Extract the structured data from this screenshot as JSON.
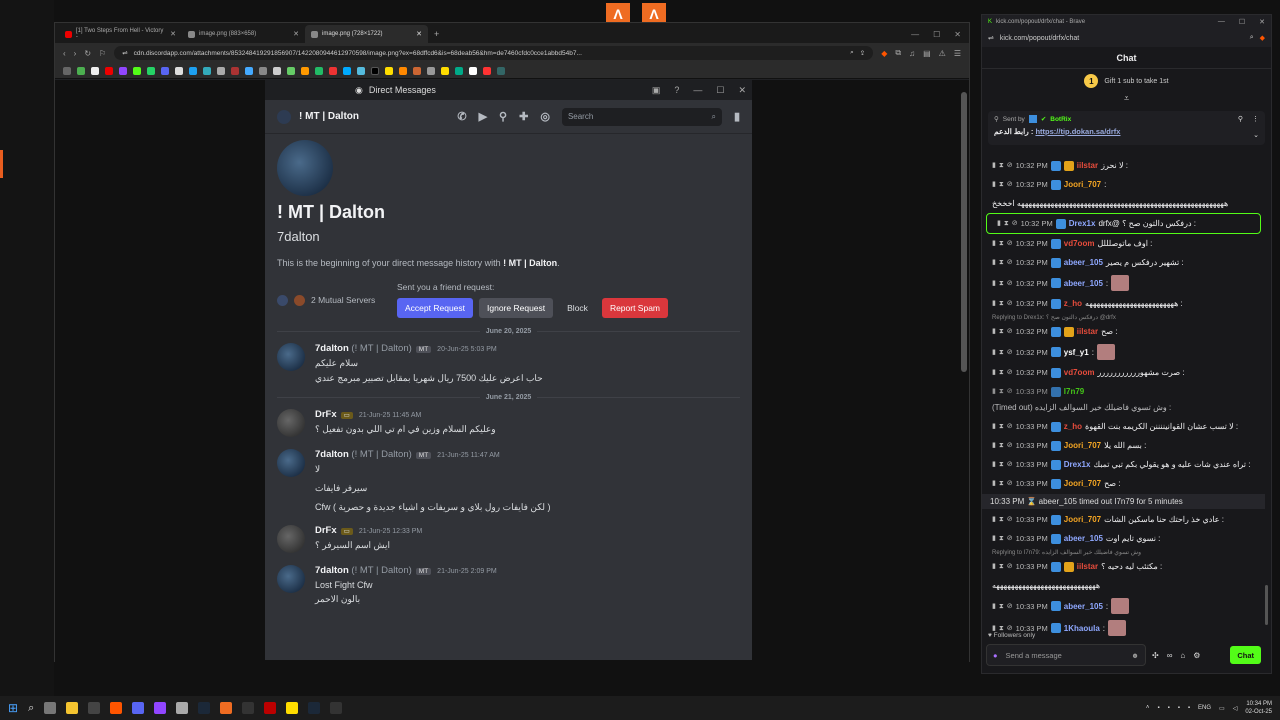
{
  "browser": {
    "tabs": [
      {
        "label": "[1] Two Steps From Hell - Victory - "
      },
      {
        "label": "image.png (883×658)"
      },
      {
        "label": "image.png (728×1722)"
      }
    ],
    "url": "cdn.discordapp.com/attachments/853248419291856907/1422080944612970598/image.png?ex=68dffcd6&is=68deab56&hm=de7460cfdc0cce1abbd54b7..."
  },
  "discord": {
    "window_title": "Direct Messages",
    "header_name": "! MT | Dalton",
    "search_placeholder": "Search",
    "profile_name": "! MT | Dalton",
    "username": "7dalton",
    "intro_prefix": "This is the beginning of your direct message history with ",
    "intro_name": "! MT | Dalton",
    "intro_suffix": ".",
    "mutual_servers": "2 Mutual Servers",
    "friend_request_label": "Sent you a friend request:",
    "accept": "Accept Request",
    "ignore": "Ignore Request",
    "block": "Block",
    "spam": "Report Spam",
    "dates": [
      "June 20, 2025",
      "June 21, 2025"
    ],
    "messages": [
      {
        "name": "7dalton",
        "sub": "(! MT | Dalton)",
        "tag": "MT",
        "time": "20-Jun-25 5:03 PM",
        "lines": [
          "سلام عليكم",
          "حاب اعرض عليك 7500 ريال شهريا بمقابل تصبير مبرمج عندي"
        ]
      },
      {
        "name": "DrFx",
        "sub": "",
        "tag": "",
        "time": "21-Jun-25 11:45 AM",
        "lines": [
          "وعليكم السلام وزين في ام تي اللي بدون تفعيل ؟"
        ]
      },
      {
        "name": "7dalton",
        "sub": "(! MT | Dalton)",
        "tag": "MT",
        "time": "21-Jun-25 11:47 AM",
        "lines": [
          "لا",
          "سيرفر فايفات",
          "Cfw ( لكن فايفات رول بلاي و سريفات و اشياء جديدة و حصرية )"
        ]
      },
      {
        "name": "DrFx",
        "sub": "",
        "tag": "",
        "time": "21-Jun-25 12:33 PM",
        "lines": [
          "ايش اسم السيرفر ؟"
        ]
      },
      {
        "name": "7dalton",
        "sub": "(! MT | Dalton)",
        "tag": "MT",
        "time": "21-Jun-25 2:09 PM",
        "lines": [
          "Lost Fight Cfw",
          "بالون الاحمر"
        ]
      }
    ]
  },
  "chat": {
    "browser_title": "kick.com/popout/drfx/chat - Brave",
    "url": "kick.com/popout/drfx/chat",
    "header": "Chat",
    "gift_count": "1",
    "gift_text": "Gift 1 sub to take 1st",
    "pinned_sent_by": "Sent by",
    "pinned_bot": "BotRix",
    "pinned_label": "رابط الدعم :",
    "pinned_link": "https://tip.dokan.sa/drfx",
    "messages": [
      {
        "time": "10:32 PM",
        "user": "iilstar",
        "color": "#e74c3c",
        "gold": true,
        "text": ": لا نحرز"
      },
      {
        "time": "10:32 PM",
        "user": "Joori_707",
        "color": "#f5a623",
        "gold": false,
        "text": ":"
      },
      {
        "time": "",
        "user": "",
        "color": "",
        "gold": false,
        "text": "ههههههههههههههههههههههههههههههههههههههههههههههههههههههههه اخخخخ"
      },
      {
        "time": "10:32 PM",
        "user": "Drex1x",
        "color": "#8fa8ff",
        "gold": false,
        "text": ": درفكس دالتون صح ؟ @drfx",
        "hl": true
      },
      {
        "time": "10:32 PM",
        "user": "vd7oom",
        "color": "#e74c3c",
        "gold": false,
        "text": ": اوف ماتوصلللل"
      },
      {
        "time": "10:32 PM",
        "user": "abeer_105",
        "color": "#8fa8ff",
        "gold": false,
        "text": ": تشهير درفكس م يصير"
      },
      {
        "time": "10:32 PM",
        "user": "abeer_105",
        "color": "#8fa8ff",
        "gold": false,
        "text": ":",
        "emote": true
      },
      {
        "time": "10:32 PM",
        "user": "z_ho",
        "color": "#e74c3c",
        "gold": false,
        "text": ": ههههههههههههههههههههههههه"
      },
      {
        "reply": "Replying to Drex1x: درفكس دالتون صح ؟ @drfx"
      },
      {
        "time": "10:32 PM",
        "user": "iilstar",
        "color": "#e74c3c",
        "gold": true,
        "text": ": صح"
      },
      {
        "time": "10:32 PM",
        "user": "ysf_y1",
        "color": "#ffffff",
        "gold": false,
        "text": ":",
        "emote": true
      },
      {
        "time": "10:32 PM",
        "user": "vd7oom",
        "color": "#e74c3c",
        "gold": false,
        "text": ": صرت مشهوررررررررررر"
      },
      {
        "time": "10:33 PM",
        "user": "I7n79",
        "color": "#53fc18",
        "gold": false,
        "text": ": وش تسوي فاضيلك خير السوالف الزايده (Timed out)",
        "dim": true
      },
      {
        "time": "10:33 PM",
        "user": "z_ho",
        "color": "#e74c3c",
        "gold": false,
        "text": ": لا تسب عشان القوانيننننن الكريمه بنت القهوة"
      },
      {
        "time": "10:33 PM",
        "user": "Joori_707",
        "color": "#f5a623",
        "gold": false,
        "text": ": بسم الله يلا"
      },
      {
        "time": "10:33 PM",
        "user": "Drex1x",
        "color": "#8fa8ff",
        "gold": false,
        "text": ": تراه عندي شات عليه و هو يقولي بكم تبي تمبك"
      },
      {
        "time": "10:33 PM",
        "user": "Joori_707",
        "color": "#f5a623",
        "gold": false,
        "text": ": صح"
      },
      {
        "system": "10:33 PM ⌛ abeer_105 timed out I7n79 for 5 minutes"
      },
      {
        "time": "10:33 PM",
        "user": "Joori_707",
        "color": "#f5a623",
        "gold": false,
        "text": ": عادي خذ راحتك حنا ماسكين الشات"
      },
      {
        "time": "10:33 PM",
        "user": "abeer_105",
        "color": "#8fa8ff",
        "gold": false,
        "text": ": نسوي تايم اوت"
      },
      {
        "reply": "Replying to I7n79: وش تسوي فاضيلك خير السوالف الزايده"
      },
      {
        "time": "10:33 PM",
        "user": "iilstar",
        "color": "#e74c3c",
        "gold": true,
        "text": ": مكتئب ليه دحيه ؟"
      },
      {
        "time": "",
        "user": "",
        "color": "",
        "gold": false,
        "text": "ههههههههههههههههههههههههههههه"
      },
      {
        "time": "10:33 PM",
        "user": "abeer_105",
        "color": "#8fa8ff",
        "gold": false,
        "text": ":",
        "emote": true
      },
      {
        "time": "10:33 PM",
        "user": "1Khaoula",
        "color": "#8fa8ff",
        "gold": false,
        "text": ":",
        "emote": true
      }
    ],
    "followers_only": "Followers only",
    "input_placeholder": "Send a message",
    "chat_button": "Chat"
  },
  "taskbar": {
    "lang": "ENG",
    "time": "10:34 PM",
    "date": "02-Oct-25"
  }
}
